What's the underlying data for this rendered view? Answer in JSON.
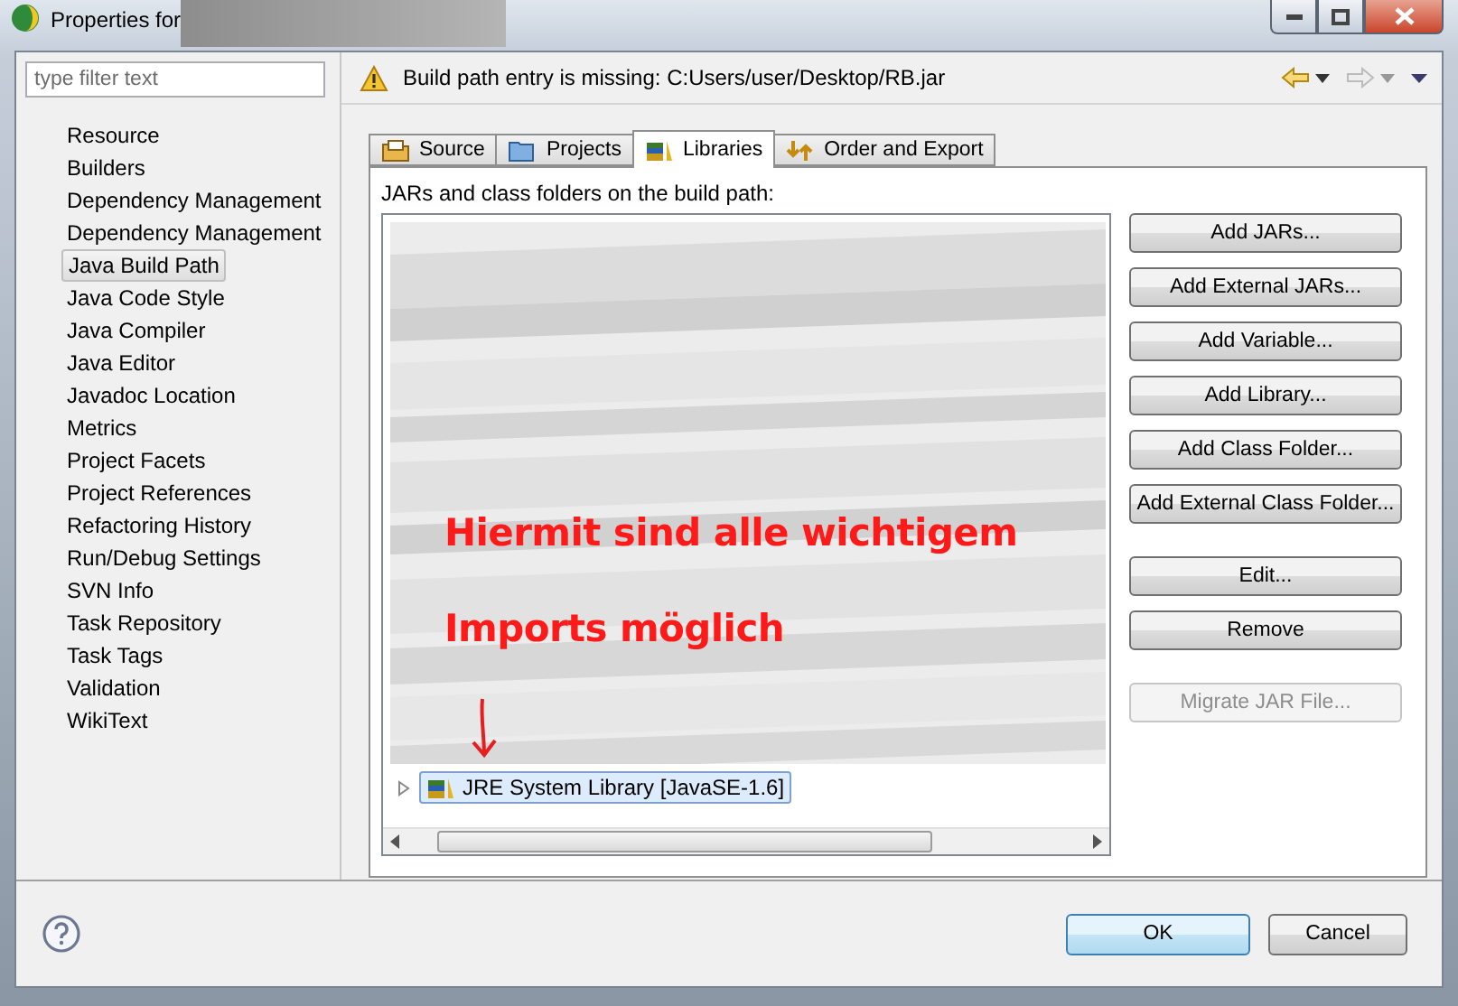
{
  "window": {
    "title": "Properties for"
  },
  "filter": {
    "placeholder": "type filter text"
  },
  "sidebar": {
    "items": [
      {
        "label": "Resource",
        "selected": false
      },
      {
        "label": "Builders",
        "selected": false
      },
      {
        "label": "Dependency Management",
        "selected": false
      },
      {
        "label": "Dependency Management",
        "selected": false
      },
      {
        "label": "Java Build Path",
        "selected": true
      },
      {
        "label": "Java Code Style",
        "selected": false
      },
      {
        "label": "Java Compiler",
        "selected": false
      },
      {
        "label": "Java Editor",
        "selected": false
      },
      {
        "label": "Javadoc Location",
        "selected": false
      },
      {
        "label": "Metrics",
        "selected": false
      },
      {
        "label": "Project Facets",
        "selected": false
      },
      {
        "label": "Project References",
        "selected": false
      },
      {
        "label": "Refactoring History",
        "selected": false
      },
      {
        "label": "Run/Debug Settings",
        "selected": false
      },
      {
        "label": "SVN Info",
        "selected": false
      },
      {
        "label": "Task Repository",
        "selected": false
      },
      {
        "label": "Task Tags",
        "selected": false
      },
      {
        "label": "Validation",
        "selected": false
      },
      {
        "label": "WikiText",
        "selected": false
      }
    ]
  },
  "message": {
    "text": "Build path entry is missing: C:Users/user/Desktop/RB.jar"
  },
  "tabs": [
    {
      "label": "Source",
      "selected": false
    },
    {
      "label": "Projects",
      "selected": false
    },
    {
      "label": "Libraries",
      "selected": true
    },
    {
      "label": "Order and Export",
      "selected": false
    }
  ],
  "panel": {
    "label": "JARs and class folders on the build path:",
    "entries": [
      {
        "label": "JRE System Library [JavaSE-1.6]",
        "expanded": false,
        "selected": true
      }
    ],
    "annotation": [
      "Hiermit sind alle wichtigem",
      "Imports möglich"
    ],
    "button_groups": [
      [
        {
          "label": "Add JARs...",
          "disabled": false
        },
        {
          "label": "Add External JARs...",
          "disabled": false
        },
        {
          "label": "Add Variable...",
          "disabled": false
        },
        {
          "label": "Add Library...",
          "disabled": false
        },
        {
          "label": "Add Class Folder...",
          "disabled": false
        },
        {
          "label": "Add External Class Folder...",
          "disabled": false
        }
      ],
      [
        {
          "label": "Edit...",
          "disabled": false
        },
        {
          "label": "Remove",
          "disabled": false
        }
      ],
      [
        {
          "label": "Migrate JAR File...",
          "disabled": true
        }
      ]
    ]
  },
  "footer": {
    "buttons": [
      {
        "label": "OK",
        "focused": true
      },
      {
        "label": "Cancel",
        "focused": false
      }
    ]
  }
}
